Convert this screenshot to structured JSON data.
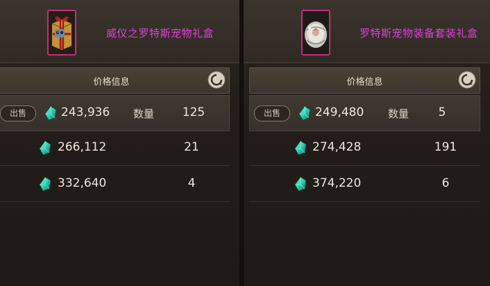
{
  "left": {
    "item_name": "威仪之罗特斯宠物礼盒",
    "price_title": "价格信息",
    "sell_label": "出售",
    "qty_label": "数量",
    "rows": [
      {
        "price": "243,936",
        "qty": "125"
      },
      {
        "price": "266,112",
        "qty": "21"
      },
      {
        "price": "332,640",
        "qty": "4"
      }
    ]
  },
  "right": {
    "item_name": "罗特斯宠物装备套装礼盒",
    "price_title": "价格信息",
    "sell_label": "出售",
    "qty_label": "数量",
    "rows": [
      {
        "price": "249,480",
        "qty": "5"
      },
      {
        "price": "274,428",
        "qty": "191"
      },
      {
        "price": "374,220",
        "qty": "6"
      }
    ]
  },
  "icons": {
    "item_left": "gift-box-icon",
    "item_right": "silver-gift-box-icon",
    "currency": "gem-icon",
    "refresh": "refresh-icon"
  },
  "colors": {
    "item_name": "#e040d8",
    "icon_border": "#c0307a",
    "gem": "#2ed0b0"
  }
}
